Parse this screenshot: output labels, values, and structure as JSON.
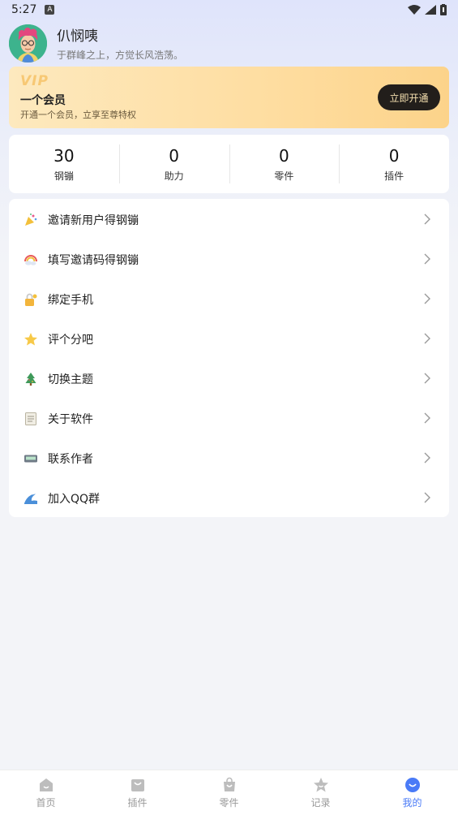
{
  "status_bar": {
    "time": "5:27",
    "notification_icon": "A"
  },
  "profile": {
    "username": "仈悯咦",
    "signature": "于群峰之上，方觉长风浩荡。"
  },
  "vip": {
    "logo": "VIP",
    "title": "一个会员",
    "description": "开通一个会员，立享至尊特权",
    "button_label": "立即开通"
  },
  "stats": [
    {
      "value": "30",
      "label": "钢镚"
    },
    {
      "value": "0",
      "label": "助力"
    },
    {
      "value": "0",
      "label": "零件"
    },
    {
      "value": "0",
      "label": "插件"
    }
  ],
  "menu": [
    {
      "label": "邀请新用户得钢镚",
      "icon": "party-popper-icon"
    },
    {
      "label": "填写邀请码得钢镚",
      "icon": "rainbow-cloud-icon"
    },
    {
      "label": "绑定手机",
      "icon": "lock-key-icon"
    },
    {
      "label": "评个分吧",
      "icon": "star-icon"
    },
    {
      "label": "切换主题",
      "icon": "christmas-tree-icon"
    },
    {
      "label": "关于软件",
      "icon": "document-icon"
    },
    {
      "label": "联系作者",
      "icon": "pager-icon"
    },
    {
      "label": "加入QQ群",
      "icon": "wave-icon"
    }
  ],
  "bottom_nav": [
    {
      "label": "首页",
      "icon": "home-icon",
      "active": false
    },
    {
      "label": "插件",
      "icon": "plugin-bag-icon",
      "active": false
    },
    {
      "label": "零件",
      "icon": "parts-bag-icon",
      "active": false
    },
    {
      "label": "记录",
      "icon": "record-star-icon",
      "active": false
    },
    {
      "label": "我的",
      "icon": "mine-smile-icon",
      "active": true
    }
  ],
  "colors": {
    "accent": "#4a7bf7",
    "vip_gold": "#fedda0",
    "vip_button": "#221e1b",
    "avatar_bg": "#3db38d"
  }
}
